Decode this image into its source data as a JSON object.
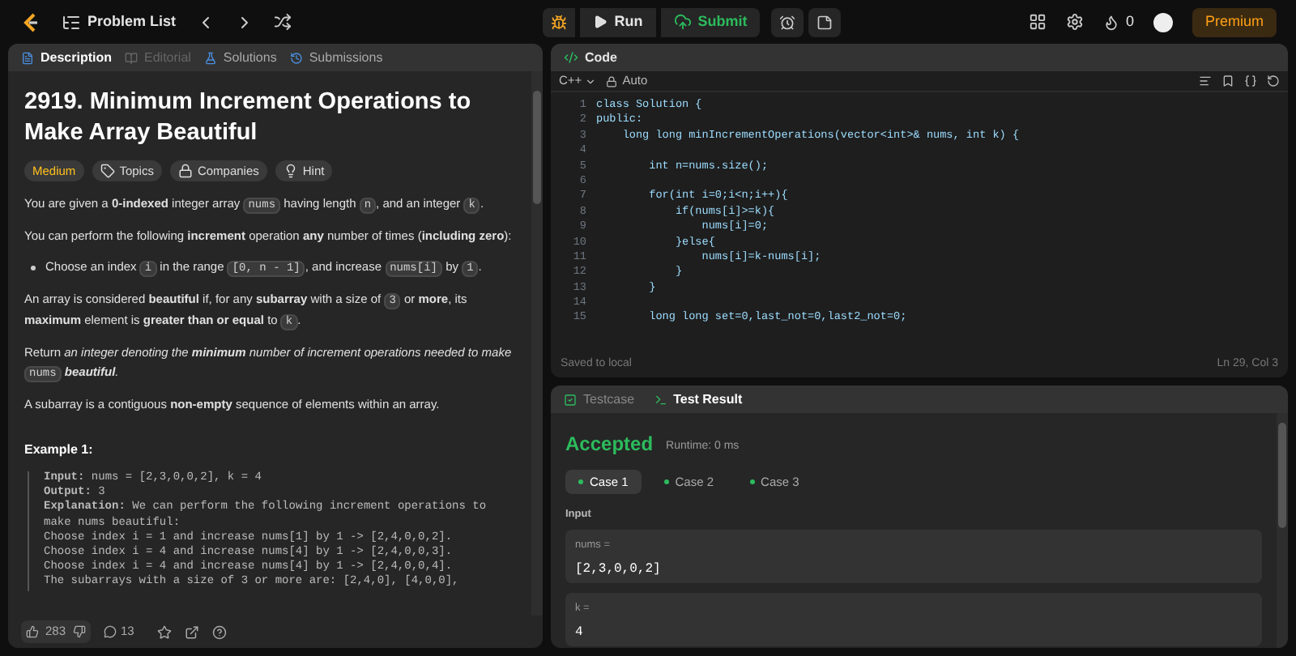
{
  "top_bar": {
    "nav_label": "Problem List",
    "run": "Run",
    "submit": "Submit",
    "streak": "0",
    "premium": "Premium"
  },
  "left_tabs": [
    {
      "label": "Description",
      "selected": true,
      "disabled": false
    },
    {
      "label": "Editorial",
      "selected": false,
      "disabled": true
    },
    {
      "label": "Solutions",
      "selected": false,
      "disabled": false
    },
    {
      "label": "Submissions",
      "selected": false,
      "disabled": false
    }
  ],
  "problem": {
    "title": "2919. Minimum Increment Operations to Make Array Beautiful",
    "tags": [
      {
        "kind": "difficulty",
        "label": "Medium"
      },
      {
        "kind": "topics",
        "label": "Topics"
      },
      {
        "kind": "companies",
        "label": "Companies"
      },
      {
        "kind": "hint",
        "label": "Hint"
      }
    ],
    "paragraphs": [
      {
        "kind": "para",
        "segments": [
          {
            "kind": "text",
            "text": "You are given a **0-indexed** integer array "
          },
          {
            "kind": "code",
            "text": "nums"
          },
          {
            "kind": "text",
            "text": " having length "
          },
          {
            "kind": "code",
            "text": "n"
          },
          {
            "kind": "text",
            "text": ", and an integer "
          },
          {
            "kind": "code",
            "text": "k"
          },
          {
            "kind": "text",
            "text": "."
          }
        ]
      },
      {
        "kind": "para",
        "segments": [
          {
            "kind": "text",
            "text": "You can perform the following **increment** operation **any** number of times (**including zero**):"
          }
        ]
      },
      {
        "kind": "bullet",
        "segments": [
          {
            "kind": "text",
            "text": "Choose an index "
          },
          {
            "kind": "code",
            "text": "i"
          },
          {
            "kind": "text",
            "text": " in the range "
          },
          {
            "kind": "code",
            "text": "[0, n - 1]"
          },
          {
            "kind": "text",
            "text": ", and increase "
          },
          {
            "kind": "code",
            "text": "nums[i]"
          },
          {
            "kind": "text",
            "text": " by "
          },
          {
            "kind": "code",
            "text": "1"
          },
          {
            "kind": "text",
            "text": "."
          }
        ]
      },
      {
        "kind": "para",
        "segments": [
          {
            "kind": "text",
            "text": "An array is considered **beautiful** if, for any **subarray** with a size of "
          },
          {
            "kind": "code",
            "text": "3"
          },
          {
            "kind": "text",
            "text": " or **more**, its **maximum** element is **greater than or equal** to "
          },
          {
            "kind": "code",
            "text": "k"
          },
          {
            "kind": "text",
            "text": "."
          }
        ]
      },
      {
        "kind": "para",
        "segments": [
          {
            "kind": "text",
            "text": "Return "
          },
          {
            "kind": "em",
            "text": "an integer denoting the **minimum** number of increment operations needed to make "
          },
          {
            "kind": "code",
            "text": "nums"
          },
          {
            "kind": "em",
            "text": " **beautiful**."
          }
        ]
      },
      {
        "kind": "para",
        "segments": [
          {
            "kind": "text",
            "text": "A subarray is a contiguous **non-empty** sequence of elements within an array."
          }
        ]
      }
    ],
    "example_title": "Example 1:",
    "example_lines": [
      "**Input:** nums = [2,3,0,0,2], k = 4",
      "**Output:** 3",
      "**Explanation:** We can perform the following increment operations to make nums beautiful:",
      "Choose index i = 1 and increase nums[1] by 1 -> [2,4,0,0,2].",
      "Choose index i = 4 and increase nums[4] by 1 -> [2,4,0,0,3].",
      "Choose index i = 4 and increase nums[4] by 1 -> [2,4,0,0,4].",
      "The subarrays with a size of 3 or more are: [2,4,0], [4,0,0],"
    ]
  },
  "footer": {
    "likes": "283",
    "comments": "13"
  },
  "editor": {
    "tab": "Code",
    "language": "C++",
    "mode": "Auto",
    "lines": [
      {
        "number": "1",
        "text": "class Solution {"
      },
      {
        "number": "2",
        "text": "public:"
      },
      {
        "number": "3",
        "text": "    long long minIncrementOperations(vector<int>& nums, int k) {"
      },
      {
        "number": "4"
      },
      {
        "number": "5",
        "text": "        int n=nums.size();"
      },
      {
        "number": "6"
      },
      {
        "number": "7",
        "text": "        for(int i=0;i<n;i++){"
      },
      {
        "number": "8",
        "text": "            if(nums[i]>=k){"
      },
      {
        "number": "9",
        "text": "                nums[i]=0;"
      },
      {
        "number": "10",
        "text": "            }else{"
      },
      {
        "number": "11",
        "text": "                nums[i]=k-nums[i];"
      },
      {
        "number": "12",
        "text": "            }"
      },
      {
        "number": "13",
        "text": "        }"
      },
      {
        "number": "14"
      },
      {
        "number": "15",
        "text": "        long long set=0,last_not=0,last2_not=0;"
      }
    ],
    "status_left": "Saved to local",
    "status_right": "Ln 29, Col 3"
  },
  "result": {
    "tabs": [
      {
        "label": "Testcase",
        "selected": false
      },
      {
        "label": "Test Result",
        "selected": true
      }
    ],
    "verdict": "Accepted",
    "runtime": "Runtime: 0 ms",
    "cases": [
      {
        "label": "Case 1",
        "selected": true
      },
      {
        "label": "Case 2",
        "selected": false
      },
      {
        "label": "Case 3",
        "selected": false
      }
    ],
    "input_label": "Input",
    "params": [
      {
        "name": "nums =",
        "value": "[2,3,0,0,2]"
      },
      {
        "name": "k =",
        "value": "4"
      }
    ]
  }
}
